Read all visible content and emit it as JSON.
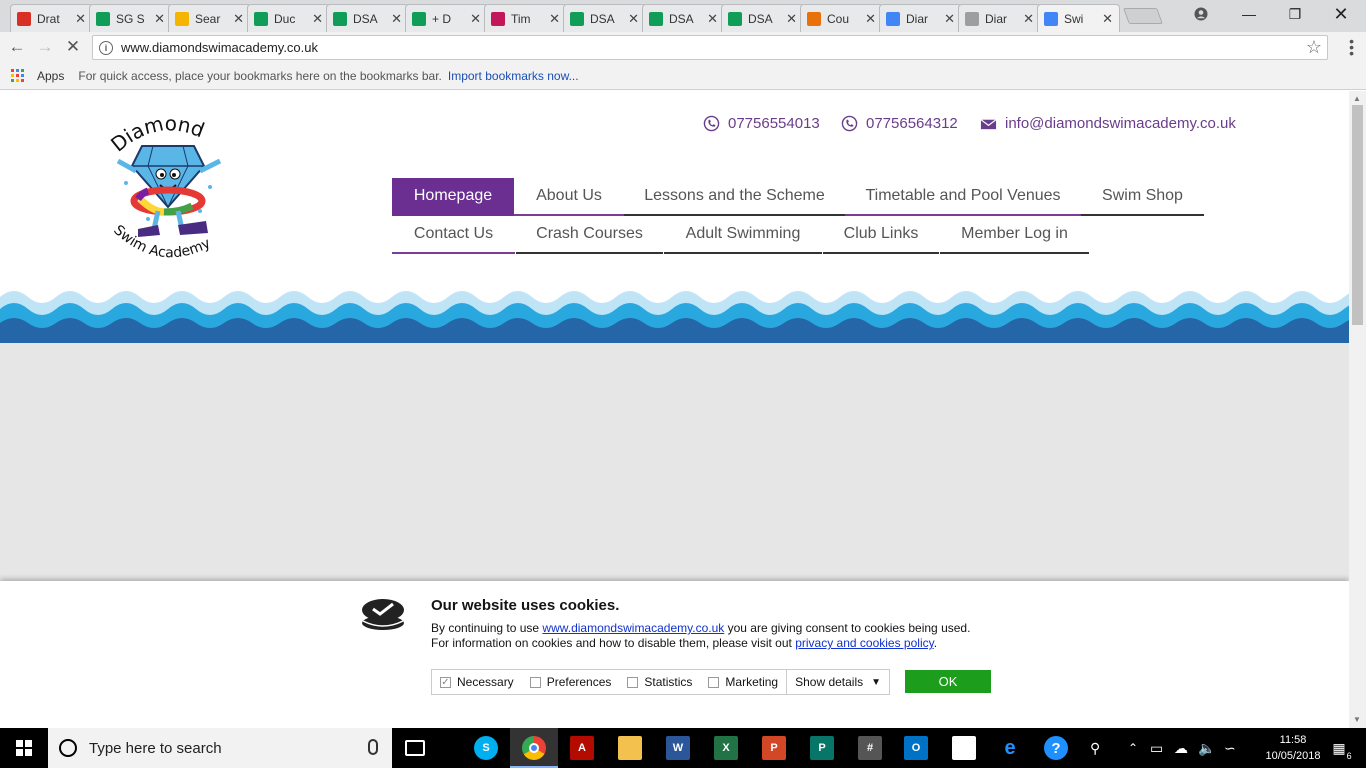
{
  "browser": {
    "tabs": [
      {
        "title": "Drat",
        "icon": "gmail-icon",
        "color": "#d93025"
      },
      {
        "title": "SG S",
        "icon": "sheets-icon",
        "color": "#0f9d58"
      },
      {
        "title": "Sear",
        "icon": "drive-icon",
        "color": "#f4b400"
      },
      {
        "title": "Duc",
        "icon": "sheets-icon",
        "color": "#0f9d58"
      },
      {
        "title": "DSA",
        "icon": "sheets-icon",
        "color": "#0f9d58"
      },
      {
        "title": "+ D",
        "icon": "sheets-icon",
        "color": "#0f9d58"
      },
      {
        "title": "Tim",
        "icon": "app-icon",
        "color": "#c2185b"
      },
      {
        "title": "DSA",
        "icon": "sheets-icon",
        "color": "#0f9d58"
      },
      {
        "title": "DSA",
        "icon": "sheets-icon",
        "color": "#0f9d58"
      },
      {
        "title": "DSA",
        "icon": "sheets-icon",
        "color": "#0f9d58"
      },
      {
        "title": "Cou",
        "icon": "app-icon",
        "color": "#e8710a"
      },
      {
        "title": "Diar",
        "icon": "docs-icon",
        "color": "#4285f4"
      },
      {
        "title": "Diar",
        "icon": "page-icon",
        "color": "#9e9e9e"
      },
      {
        "title": "Swi",
        "icon": "loading-icon",
        "color": "#4285f4"
      }
    ],
    "url": "www.diamondswimacademy.co.uk",
    "bookmarks": {
      "apps_label": "Apps",
      "hint": "For quick access, place your bookmarks here on the bookmarks bar.",
      "import_link": "Import bookmarks now..."
    }
  },
  "site": {
    "logo": {
      "top_text": "Diamond",
      "bottom_text": "Swim Academy"
    },
    "contacts": {
      "phone1": "07756554013",
      "phone2": "07756564312",
      "email": "info@diamondswimacademy.co.uk"
    },
    "nav_row1": [
      "Homepage",
      "About Us",
      "Lessons and the Scheme",
      "Timetable and Pool Venues",
      "Swim Shop"
    ],
    "nav_row2": [
      "Contact Us",
      "Crash Courses",
      "Adult Swimming",
      "Club Links",
      "Member Log in"
    ],
    "active_nav": "Homepage",
    "accent": "#6a2f91"
  },
  "cookie": {
    "title": "Our website uses cookies.",
    "text_before": "By continuing to use ",
    "site_link": "www.diamondswimacademy.co.uk",
    "text_middle": " you are giving consent to cookies being used. For information on cookies and how to disable them, please visit out ",
    "policy_link": "privacy and cookies policy",
    "text_end": ".",
    "options": [
      "Necessary",
      "Preferences",
      "Statistics",
      "Marketing"
    ],
    "show_details": "Show details",
    "ok": "OK"
  },
  "taskbar": {
    "search_placeholder": "Type here to search",
    "time": "11:58",
    "date": "10/05/2018",
    "notification_count": "6"
  }
}
